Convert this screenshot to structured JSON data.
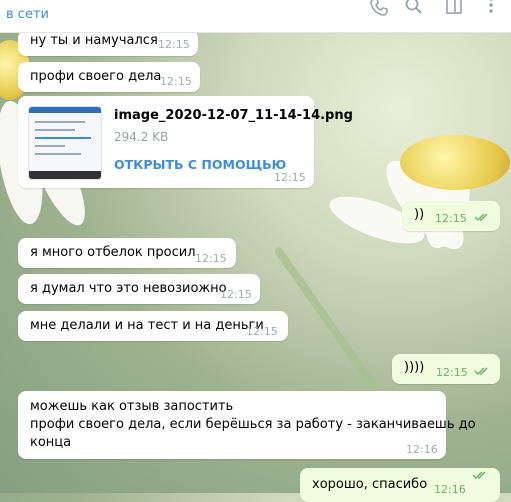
{
  "header": {
    "status": "в сети",
    "icons": [
      "phone-icon",
      "search-icon",
      "sidebar-toggle-icon",
      "more-icon"
    ]
  },
  "messages": [
    {
      "text": "ну ты и намучался",
      "time": "12:15",
      "direction": "in"
    },
    {
      "text": "профи своего дела",
      "time": "12:15",
      "direction": "in"
    },
    {
      "file": {
        "name": "image_2020-12-07_11-14-14.png",
        "size": "294.2 KB",
        "action": "ОТКРЫТЬ С ПОМОЩЬЮ"
      },
      "time": "12:15",
      "direction": "in"
    },
    {
      "text": "))",
      "time": "12:15",
      "direction": "out",
      "read": true
    },
    {
      "text": "я много отбелок просил",
      "time": "12:15",
      "direction": "in"
    },
    {
      "text": "я думал что это невозиожно",
      "time": "12:15",
      "direction": "in"
    },
    {
      "text": "мне делали и на тест и на деньги",
      "time": "12:15",
      "direction": "in"
    },
    {
      "text": "))))",
      "time": "12:15",
      "direction": "out",
      "read": true
    },
    {
      "lines": [
        "можешь как отзыв запостить",
        "профи своего дела, если берёшься за работу - заканчиваешь до",
        "конца"
      ],
      "time": "12:16",
      "direction": "in"
    },
    {
      "text": "хорошо, спасибо",
      "time": "12:16",
      "direction": "out",
      "read": true
    }
  ],
  "colors": {
    "accent": "#3a8fd8",
    "outgoing_bubble": "#effdde",
    "read_check": "#6cb06a"
  }
}
